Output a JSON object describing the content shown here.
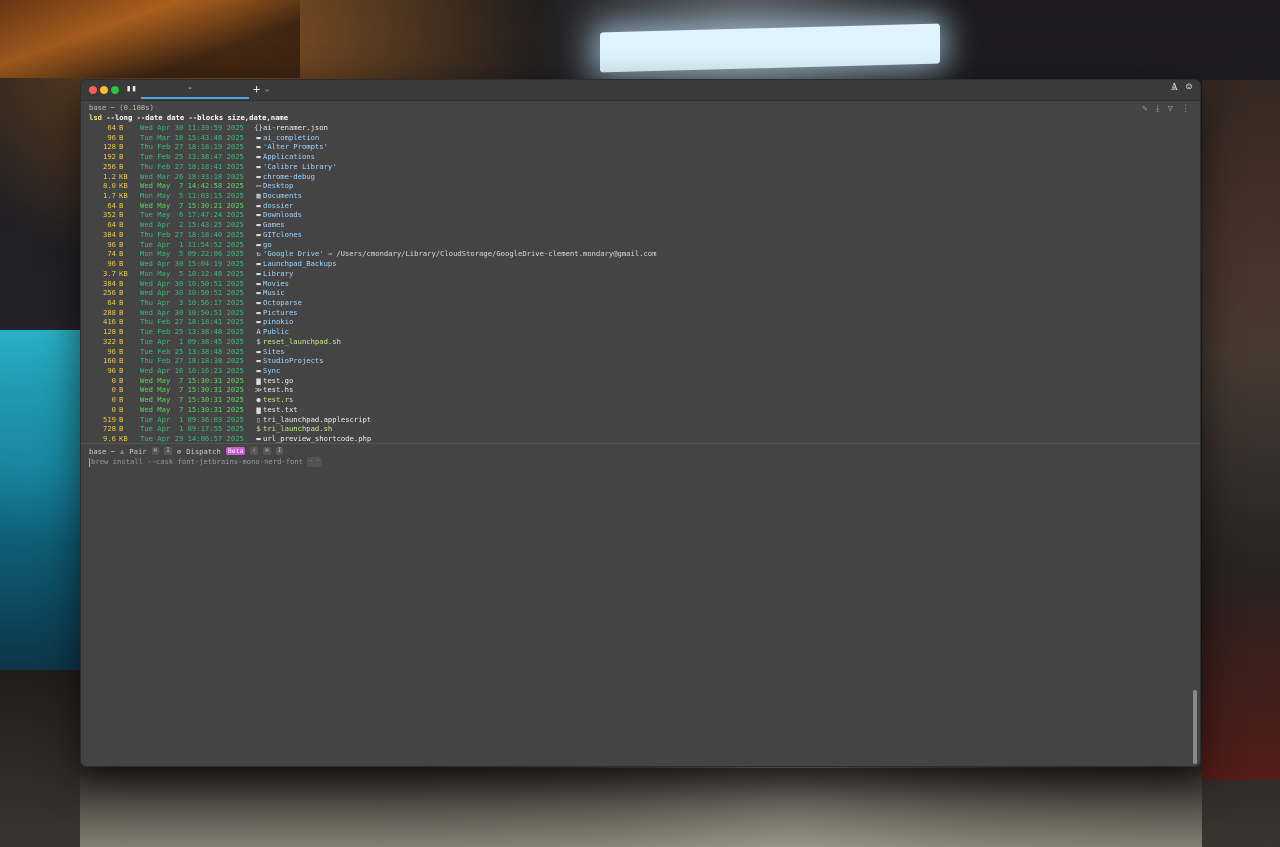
{
  "terminal": {
    "header": "base ~ (0.108s)",
    "command": {
      "name": "lsd",
      "args": "--long --date date --blocks size,date,name"
    },
    "entries": [
      {
        "size": "64",
        "unit": "B",
        "date": "Wed Apr 30 11:39:59 2025",
        "icon": "{}",
        "name": "ai-renamer.json",
        "kind": "file"
      },
      {
        "size": "96",
        "unit": "B",
        "date": "Tue Mar 18 15:43:48 2025",
        "icon": "▬",
        "name": "ai_completion",
        "kind": "dir"
      },
      {
        "size": "128",
        "unit": "B",
        "date": "Thu Feb 27 18:18:19 2025",
        "icon": "▬",
        "name": "'Alter Prompts'",
        "kind": "dir"
      },
      {
        "size": "192",
        "unit": "B",
        "date": "Tue Feb 25 13:38:47 2025",
        "icon": "▬",
        "name": "Applications",
        "kind": "dir"
      },
      {
        "size": "256",
        "unit": "B",
        "date": "Thu Feb 27 18:18:41 2025",
        "icon": "▬",
        "name": "'Calibre Library'",
        "kind": "dir"
      },
      {
        "size": "1.2",
        "unit": "KB",
        "date": "Wed Mar 26 18:33:18 2025",
        "icon": "▬",
        "name": "chrome-debug",
        "kind": "dir"
      },
      {
        "size": "8.0",
        "unit": "KB",
        "date": "Wed May  7 14:42:58 2025",
        "icon": "▭",
        "name": "Desktop",
        "kind": "dir",
        "hl": true
      },
      {
        "size": "1.7",
        "unit": "KB",
        "date": "Mon May  5 11:03:15 2025",
        "icon": "▦",
        "name": "Documents",
        "kind": "dir"
      },
      {
        "size": "64",
        "unit": "B",
        "date": "Wed May  7 15:30:21 2025",
        "icon": "▬",
        "name": "dossier",
        "kind": "dir",
        "hl": true
      },
      {
        "size": "352",
        "unit": "B",
        "date": "Tue May  6 17:47:24 2025",
        "icon": "▬",
        "name": "Downloads",
        "kind": "dir"
      },
      {
        "size": "64",
        "unit": "B",
        "date": "Wed Apr  2 15:43:25 2025",
        "icon": "▬",
        "name": "Games",
        "kind": "dir"
      },
      {
        "size": "384",
        "unit": "B",
        "date": "Thu Feb 27 18:18:40 2025",
        "icon": "▬",
        "name": "GITclones",
        "kind": "dir"
      },
      {
        "size": "96",
        "unit": "B",
        "date": "Tue Apr  1 11:54:52 2025",
        "icon": "▬",
        "name": "go",
        "kind": "dir"
      },
      {
        "size": "74",
        "unit": "B",
        "date": "Mon May  5 09:22:06 2025",
        "icon": "↻",
        "name": "'Google Drive'",
        "kind": "link",
        "target": "⇒ /Users/cmondary/Library/CloudStorage/GoogleDrive-clement.mondary@gmail.com"
      },
      {
        "size": "96",
        "unit": "B",
        "date": "Wed Apr 30 15:04:19 2025",
        "icon": "▬",
        "name": "Launchpad_Backups",
        "kind": "dir"
      },
      {
        "size": "3.7",
        "unit": "KB",
        "date": "Mon May  5 10:12:48 2025",
        "icon": "▬",
        "name": "Library",
        "kind": "dir"
      },
      {
        "size": "384",
        "unit": "B",
        "date": "Wed Apr 30 10:50:51 2025",
        "icon": "▬",
        "name": "Movies",
        "kind": "dir"
      },
      {
        "size": "256",
        "unit": "B",
        "date": "Wed Apr 30 10:50:51 2025",
        "icon": "▬",
        "name": "Music",
        "kind": "dir"
      },
      {
        "size": "64",
        "unit": "B",
        "date": "Thu Apr  3 10:56:17 2025",
        "icon": "▬",
        "name": "Octoparse",
        "kind": "dir"
      },
      {
        "size": "288",
        "unit": "B",
        "date": "Wed Apr 30 10:50:51 2025",
        "icon": "▬",
        "name": "Pictures",
        "kind": "dir"
      },
      {
        "size": "416",
        "unit": "B",
        "date": "Thu Feb 27 18:18:41 2025",
        "icon": "▬",
        "name": "pinokio",
        "kind": "dir"
      },
      {
        "size": "128",
        "unit": "B",
        "date": "Tue Feb 25 13:38:48 2025",
        "icon": "A",
        "name": "Public",
        "kind": "dir"
      },
      {
        "size": "322",
        "unit": "B",
        "date": "Tue Apr  1 09:38:45 2025",
        "icon": "$",
        "name": "reset_launchpad.sh",
        "kind": "exec"
      },
      {
        "size": "96",
        "unit": "B",
        "date": "Tue Feb 25 13:38:48 2025",
        "icon": "▬",
        "name": "Sites",
        "kind": "dir"
      },
      {
        "size": "160",
        "unit": "B",
        "date": "Thu Feb 27 18:18:38 2025",
        "icon": "▬",
        "name": "StudioProjects",
        "kind": "dir"
      },
      {
        "size": "96",
        "unit": "B",
        "date": "Wed Apr 16 10:16:23 2025",
        "icon": "▬",
        "name": "Sync",
        "kind": "dir"
      },
      {
        "size": "0",
        "unit": "B",
        "date": "Wed May  7 15:30:31 2025",
        "icon": "▆",
        "name": "test.go",
        "kind": "file",
        "hl": true
      },
      {
        "size": "0",
        "unit": "B",
        "date": "Wed May  7 15:30:31 2025",
        "icon": "≫",
        "name": "test.hs",
        "kind": "file",
        "hl": true
      },
      {
        "size": "0",
        "unit": "B",
        "date": "Wed May  7 15:30:31 2025",
        "icon": "●",
        "name": "test.rs",
        "kind": "exec",
        "hl": true
      },
      {
        "size": "0",
        "unit": "B",
        "date": "Wed May  7 15:30:31 2025",
        "icon": "▆",
        "name": "test.txt",
        "kind": "file",
        "hl": true
      },
      {
        "size": "519",
        "unit": "B",
        "date": "Tue Apr  1 09:36:03 2025",
        "icon": "▯",
        "name": "tri_launchpad.applescript",
        "kind": "file"
      },
      {
        "size": "728",
        "unit": "B",
        "date": "Tue Apr  1 09:17:55 2025",
        "icon": "$",
        "name": "tri_launchpad.sh",
        "kind": "exec"
      },
      {
        "size": "9.6",
        "unit": "KB",
        "date": "Tue Apr 29 14:06:57 2025",
        "icon": "▬",
        "name": "url_preview_shortcode.php",
        "kind": "file"
      }
    ]
  },
  "prompt_bar": {
    "env": "base ~",
    "pair_label": "Pair",
    "dispatch_label": "Dispatch",
    "beta_label": "Beta",
    "input_text": "brew install --cask font-jetbrains-mono-nerd-font",
    "input_hint": "→ ↩"
  },
  "colors": {
    "accent": "#4aa8e8",
    "size": "#e8c84a",
    "date": "#3cb87c",
    "dir_name": "#9fd7ff",
    "beta_badge": "#c45ad8"
  }
}
